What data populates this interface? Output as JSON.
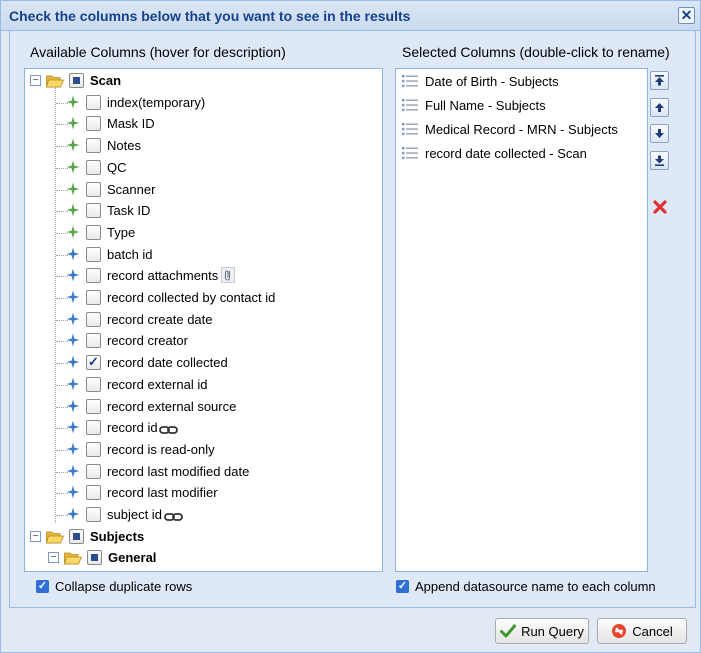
{
  "dialog": {
    "title": "Check the columns below that you want to see in the results",
    "close_glyph": "✕"
  },
  "available": {
    "header": "Available Columns (hover for description)",
    "root": {
      "label": "Scan",
      "state": "partial"
    },
    "items": [
      {
        "label": "index(temporary)",
        "icon": "green-star-icon",
        "checked": false,
        "suffix": ""
      },
      {
        "label": "Mask ID",
        "icon": "green-star-icon",
        "checked": false,
        "suffix": ""
      },
      {
        "label": "Notes",
        "icon": "green-star-icon",
        "checked": false,
        "suffix": ""
      },
      {
        "label": "QC",
        "icon": "green-star-icon",
        "checked": false,
        "suffix": ""
      },
      {
        "label": "Scanner",
        "icon": "green-star-icon",
        "checked": false,
        "suffix": ""
      },
      {
        "label": "Task ID",
        "icon": "green-star-icon",
        "checked": false,
        "suffix": ""
      },
      {
        "label": "Type",
        "icon": "green-star-icon",
        "checked": false,
        "suffix": ""
      },
      {
        "label": "batch id",
        "icon": "blue-star-icon",
        "checked": false,
        "suffix": ""
      },
      {
        "label": "record attachments",
        "icon": "blue-star-icon",
        "checked": false,
        "suffix": "attachment-icon"
      },
      {
        "label": "record collected by contact id",
        "icon": "blue-star-icon",
        "checked": false,
        "suffix": ""
      },
      {
        "label": "record create date",
        "icon": "blue-star-icon",
        "checked": false,
        "suffix": ""
      },
      {
        "label": "record creator",
        "icon": "blue-star-icon",
        "checked": false,
        "suffix": ""
      },
      {
        "label": "record date collected",
        "icon": "blue-star-icon",
        "checked": true,
        "suffix": ""
      },
      {
        "label": "record external id",
        "icon": "blue-star-icon",
        "checked": false,
        "suffix": ""
      },
      {
        "label": "record external source",
        "icon": "blue-star-icon",
        "checked": false,
        "suffix": ""
      },
      {
        "label": "record id",
        "icon": "blue-star-icon",
        "checked": false,
        "suffix": "link-icon"
      },
      {
        "label": "record is read-only",
        "icon": "blue-star-icon",
        "checked": false,
        "suffix": ""
      },
      {
        "label": "record last modified date",
        "icon": "blue-star-icon",
        "checked": false,
        "suffix": ""
      },
      {
        "label": "record last modifier",
        "icon": "blue-star-icon",
        "checked": false,
        "suffix": ""
      },
      {
        "label": "subject id",
        "icon": "blue-star-icon",
        "checked": false,
        "suffix": "link-icon"
      }
    ],
    "subjects": {
      "label": "Subjects",
      "state": "partial"
    },
    "general": {
      "label": "General",
      "state": "partial"
    }
  },
  "selected": {
    "header": "Selected Columns (double-click to rename)",
    "items": [
      "Date of Birth - Subjects",
      "Full Name - Subjects",
      "Medical Record - MRN - Subjects",
      "record date collected - Scan"
    ]
  },
  "side_buttons": [
    "move-top-icon",
    "move-up-icon",
    "move-down-icon",
    "move-bottom-icon"
  ],
  "options": {
    "collapse_label": "Collapse duplicate rows",
    "collapse_checked": true,
    "append_label": "Append datasource name to each column",
    "append_checked": true
  },
  "footer": {
    "run_label": "Run Query",
    "cancel_label": "Cancel"
  },
  "colors": {
    "title": "#15428b",
    "green_star": "#5aa54a",
    "blue_star": "#3d7cc9",
    "check_blue": "#2f6fd6"
  }
}
